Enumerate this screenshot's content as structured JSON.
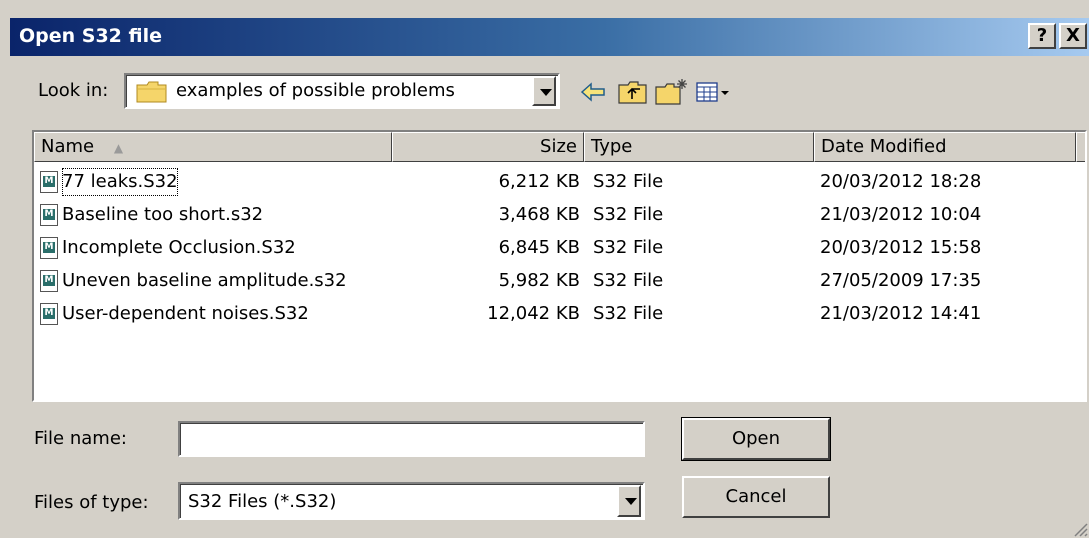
{
  "window": {
    "title": "Open S32 file",
    "help_label": "?",
    "close_label": "X"
  },
  "look_in": {
    "label": "Look in:",
    "value": "examples of possible problems",
    "toolbar_icons": [
      "back-arrow-icon",
      "up-folder-icon",
      "new-folder-icon",
      "view-menu-icon"
    ]
  },
  "list": {
    "columns": [
      "Name",
      "Size",
      "Type",
      "Date Modified"
    ],
    "rows": [
      {
        "name": "77 leaks.S32",
        "size": "6,212 KB",
        "type": "S32 File",
        "date": "20/03/2012 18:28"
      },
      {
        "name": "Baseline too short.s32",
        "size": "3,468 KB",
        "type": "S32 File",
        "date": "21/03/2012 10:04"
      },
      {
        "name": "Incomplete Occlusion.S32",
        "size": "6,845 KB",
        "type": "S32 File",
        "date": "20/03/2012 15:58"
      },
      {
        "name": "Uneven baseline amplitude.s32",
        "size": "5,982 KB",
        "type": "S32 File",
        "date": "27/05/2009 17:35"
      },
      {
        "name": "User-dependent noises.S32",
        "size": "12,042 KB",
        "type": "S32 File",
        "date": "21/03/2012 14:41"
      }
    ]
  },
  "file_name": {
    "label": "File name:",
    "value": ""
  },
  "file_type": {
    "label": "Files of type:",
    "value": "S32 Files (*.S32)"
  },
  "buttons": {
    "open": "Open",
    "cancel": "Cancel"
  },
  "colors": {
    "title_start": "#0a246a",
    "title_end": "#a6caf0",
    "face": "#d4d0c8"
  }
}
